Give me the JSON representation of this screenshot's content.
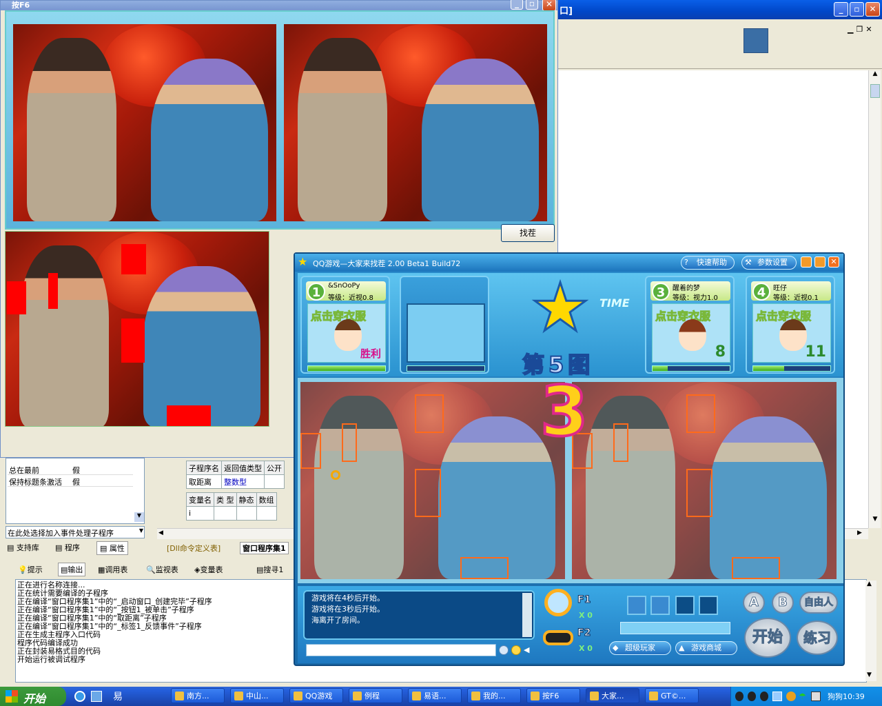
{
  "ide": {
    "title_suffix": "口]",
    "props": [
      {
        "name": "总在最前",
        "value": "假"
      },
      {
        "name": "保持标题条激活",
        "value": "假"
      }
    ],
    "event_select": "在此处选择加入事件处理子程序",
    "left_tabs": [
      "支持库",
      "程序",
      "属性"
    ],
    "sub_headers": [
      "子程序名",
      "返回值类型",
      "公开"
    ],
    "sub_row": {
      "name": "取距离",
      "type": "整数型"
    },
    "var_headers": [
      "变量名",
      "类 型",
      "静态",
      "数组"
    ],
    "var_row": "i",
    "doc_tabs": [
      "[Dll命令定义表]",
      "窗口程序集1"
    ],
    "output_tabs": [
      "提示",
      "输出",
      "调用表",
      "监视表",
      "变量表",
      "搜寻1"
    ],
    "output_lines": [
      "正在进行名称连接...",
      "正在统计需要编译的子程序",
      "正在编译“窗口程序集1”中的“_启动窗口_创建完毕”子程序",
      "正在编译“窗口程序集1”中的“_按钮1_被单击”子程序",
      "正在编译“窗口程序集1”中的“取距离”子程序",
      "正在编译“窗口程序集1”中的“_标签1_反馈事件”子程序",
      "正在生成主程序入口代码",
      "程序代码编译成功",
      "正在封装易格式目的代码",
      "开始运行被调试程序"
    ]
  },
  "helper": {
    "title": "按F6",
    "find_button": "找茬"
  },
  "game": {
    "title": "QQ游戏—大家来找茬 2.00  Beta1  Build72",
    "quick_help": "快速帮助",
    "settings": "参数设置",
    "time_label": "TIME",
    "round_label": "第5图",
    "countdown": "3",
    "players": [
      {
        "num": "1",
        "name": "&SnOoPy",
        "level": "等级：近视0.8",
        "hint": "点击穿衣服",
        "score": "胜利",
        "progress": 1.0
      },
      {
        "num": "3",
        "name": "醒着的梦",
        "level": "等级：视力1.0",
        "hint": "点击穿衣服",
        "score": "8",
        "progress": 0.2
      },
      {
        "num": "4",
        "name": "旺仔",
        "level": "等级：近视0.1",
        "hint": "点击穿衣服",
        "score": "11",
        "progress": 0.4
      }
    ],
    "chat_lines": [
      "游戏将在4秒后开始。",
      "游戏将在3秒后开始。",
      "海离开了房间。"
    ],
    "f1_label": "F1",
    "f1_count": "X 0",
    "f2_label": "F2",
    "f2_count": "X 0",
    "super_player": "超级玩家",
    "shop": "游戏商城",
    "btn_a": "A",
    "btn_b": "B",
    "btn_free": "自由人",
    "btn_start": "开始",
    "btn_practice": "练习"
  },
  "taskbar": {
    "start": "开始",
    "items": [
      "南方...",
      "中山...",
      "QQ游戏",
      "例程",
      "易语...",
      "我的...",
      "按F6",
      "大家...",
      "GT©..."
    ],
    "active_index": 7,
    "clock": "狗狗10:39"
  }
}
